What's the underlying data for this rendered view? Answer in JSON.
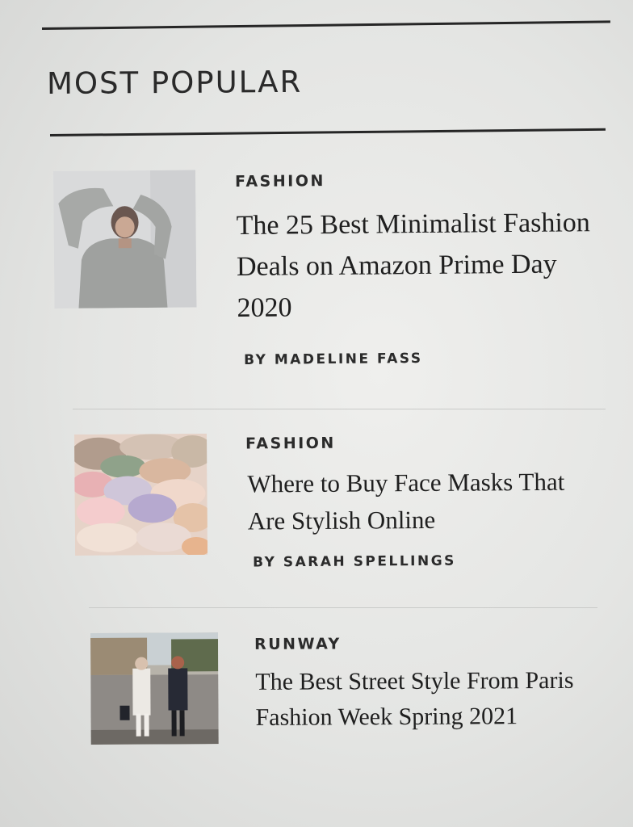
{
  "section": {
    "title": "MOST POPULAR"
  },
  "articles": [
    {
      "category": "FASHION",
      "headline": "The 25 Best Minimalist Fashion Deals on Amazon Prime Day 2020",
      "byline": "BY MADELINE FASS"
    },
    {
      "category": "FASHION",
      "headline": "Where to Buy Face Masks That Are Stylish Online",
      "byline": "BY SARAH SPELLINGS"
    },
    {
      "category": "RUNWAY",
      "headline": "The Best Street Style From Paris Fashion Week Spring 2021"
    }
  ],
  "colors": {
    "text": "#1e1e1e",
    "rule": "#262626",
    "background": "#e6e7e5"
  }
}
